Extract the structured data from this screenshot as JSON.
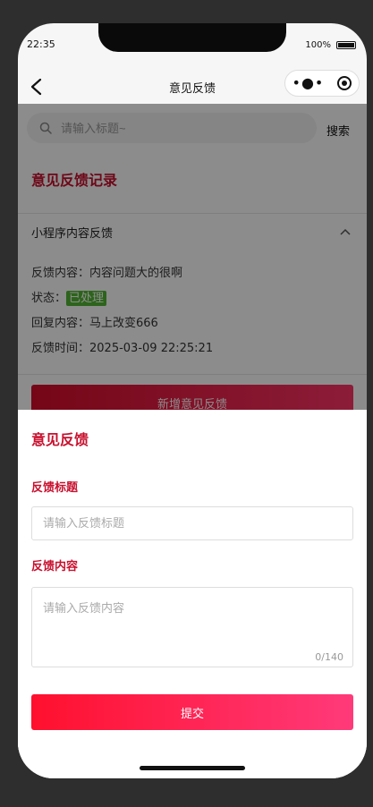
{
  "status": {
    "time": "22:35",
    "battery": "100%"
  },
  "nav": {
    "title": "意见反馈"
  },
  "search": {
    "placeholder": "请输入标题~",
    "button": "搜索"
  },
  "records": {
    "title": "意见反馈记录",
    "title_shadow": "TRUE",
    "item": {
      "heading": "小程序内容反馈",
      "content_label": "反馈内容：",
      "content": "内容问题大的很啊",
      "status_label": "状态：",
      "status": "已处理",
      "reply_label": "回复内容：",
      "reply": "马上改变666",
      "time_label": "反馈时间：",
      "time": "2025-03-09 22:25:21"
    },
    "add_button": "新增意见反馈"
  },
  "sheet": {
    "title": "意见反馈",
    "title_shadow": "TRUE",
    "title_label": "反馈标题",
    "title_placeholder": "请输入反馈标题",
    "content_label": "反馈内容",
    "content_placeholder": "请输入反馈内容",
    "counter": "0/140",
    "submit": "提交"
  },
  "colors": {
    "accent": "#c8102e",
    "badge": "#52b733"
  }
}
